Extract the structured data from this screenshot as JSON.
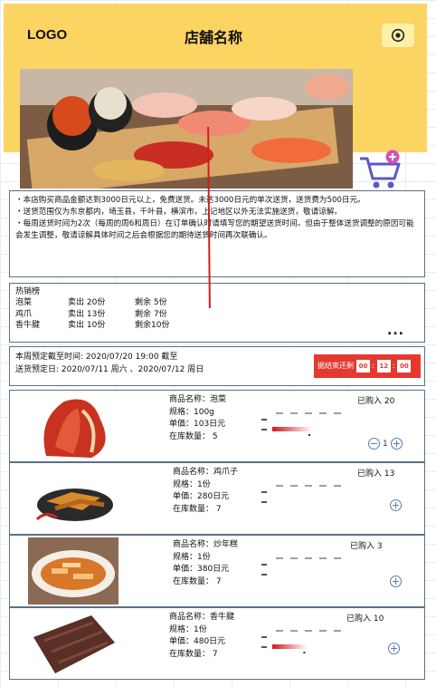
{
  "header": {
    "logo": "LOGO",
    "store_name": "店舗名称",
    "settings_icon": "target-icon"
  },
  "hero": {
    "icon": "sushi-photo"
  },
  "cart": {
    "icon": "cart-plus-icon"
  },
  "notice": {
    "lines": [
      "・本店购买商品金额达到3000日元以上，免费送货。未达3000日元的单次送货，送货费为500日元。",
      "・送货范围仅为东京都内，埼玉县，千叶县，横滨市，上记地区以外无法实施送货，敬请谅解。",
      "・每周送货时间为2次（每周的周6和周日）在订单确认时请填写您的期望送货时间。但由于整体送货调整的原因可能会发生调整，敬请谅解具体时间之后会根据您的期待送货时间再次联确认。"
    ]
  },
  "best_sellers": {
    "title": "热销榜",
    "items": [
      {
        "name": "泡菜",
        "sold": "卖出 20份",
        "left": "剩余 5份"
      },
      {
        "name": "鸡爪",
        "sold": "卖出 13份",
        "left": "剩余 7份"
      },
      {
        "name": "香牛腱",
        "sold": "卖出 10份",
        "left": "剩余10份"
      }
    ],
    "more": "..."
  },
  "deadline": {
    "line1": "本周预定截至时间:  2020/07/20   19:00 截至",
    "line2": "送货预定日: 2020/07/11  周六 、2020/07/12  周日",
    "countdown_label": "据结束还剩",
    "cd_h": "00",
    "cd_m": "12",
    "cd_s": "00",
    "sep": ":"
  },
  "products": [
    {
      "name": "商品名称：泡菜",
      "spec": "规格：100g",
      "price": "单価：103日元",
      "stock": "在库数量： 5",
      "purchased": "已购入 20",
      "qty": "1",
      "chart_fill": 0.55
    },
    {
      "name": "商品名称：鸡爪子",
      "spec": "规格：1份",
      "price": "单価：280日元",
      "stock": "在库数量： 7",
      "purchased": "已购入 13",
      "chart_fill": 0.0
    },
    {
      "name": "商品名称：炒年糕",
      "spec": "规格：1份",
      "price": "单価：380日元",
      "stock": "在库数量： 7",
      "purchased": "已购入 3",
      "chart_fill": 0.0
    },
    {
      "name": "商品名称：香牛腱",
      "spec": "规格：1份",
      "price": "单価：480日元",
      "stock": "在库数量： 7",
      "purchased": "已购入 10",
      "chart_fill": 0.48
    }
  ]
}
